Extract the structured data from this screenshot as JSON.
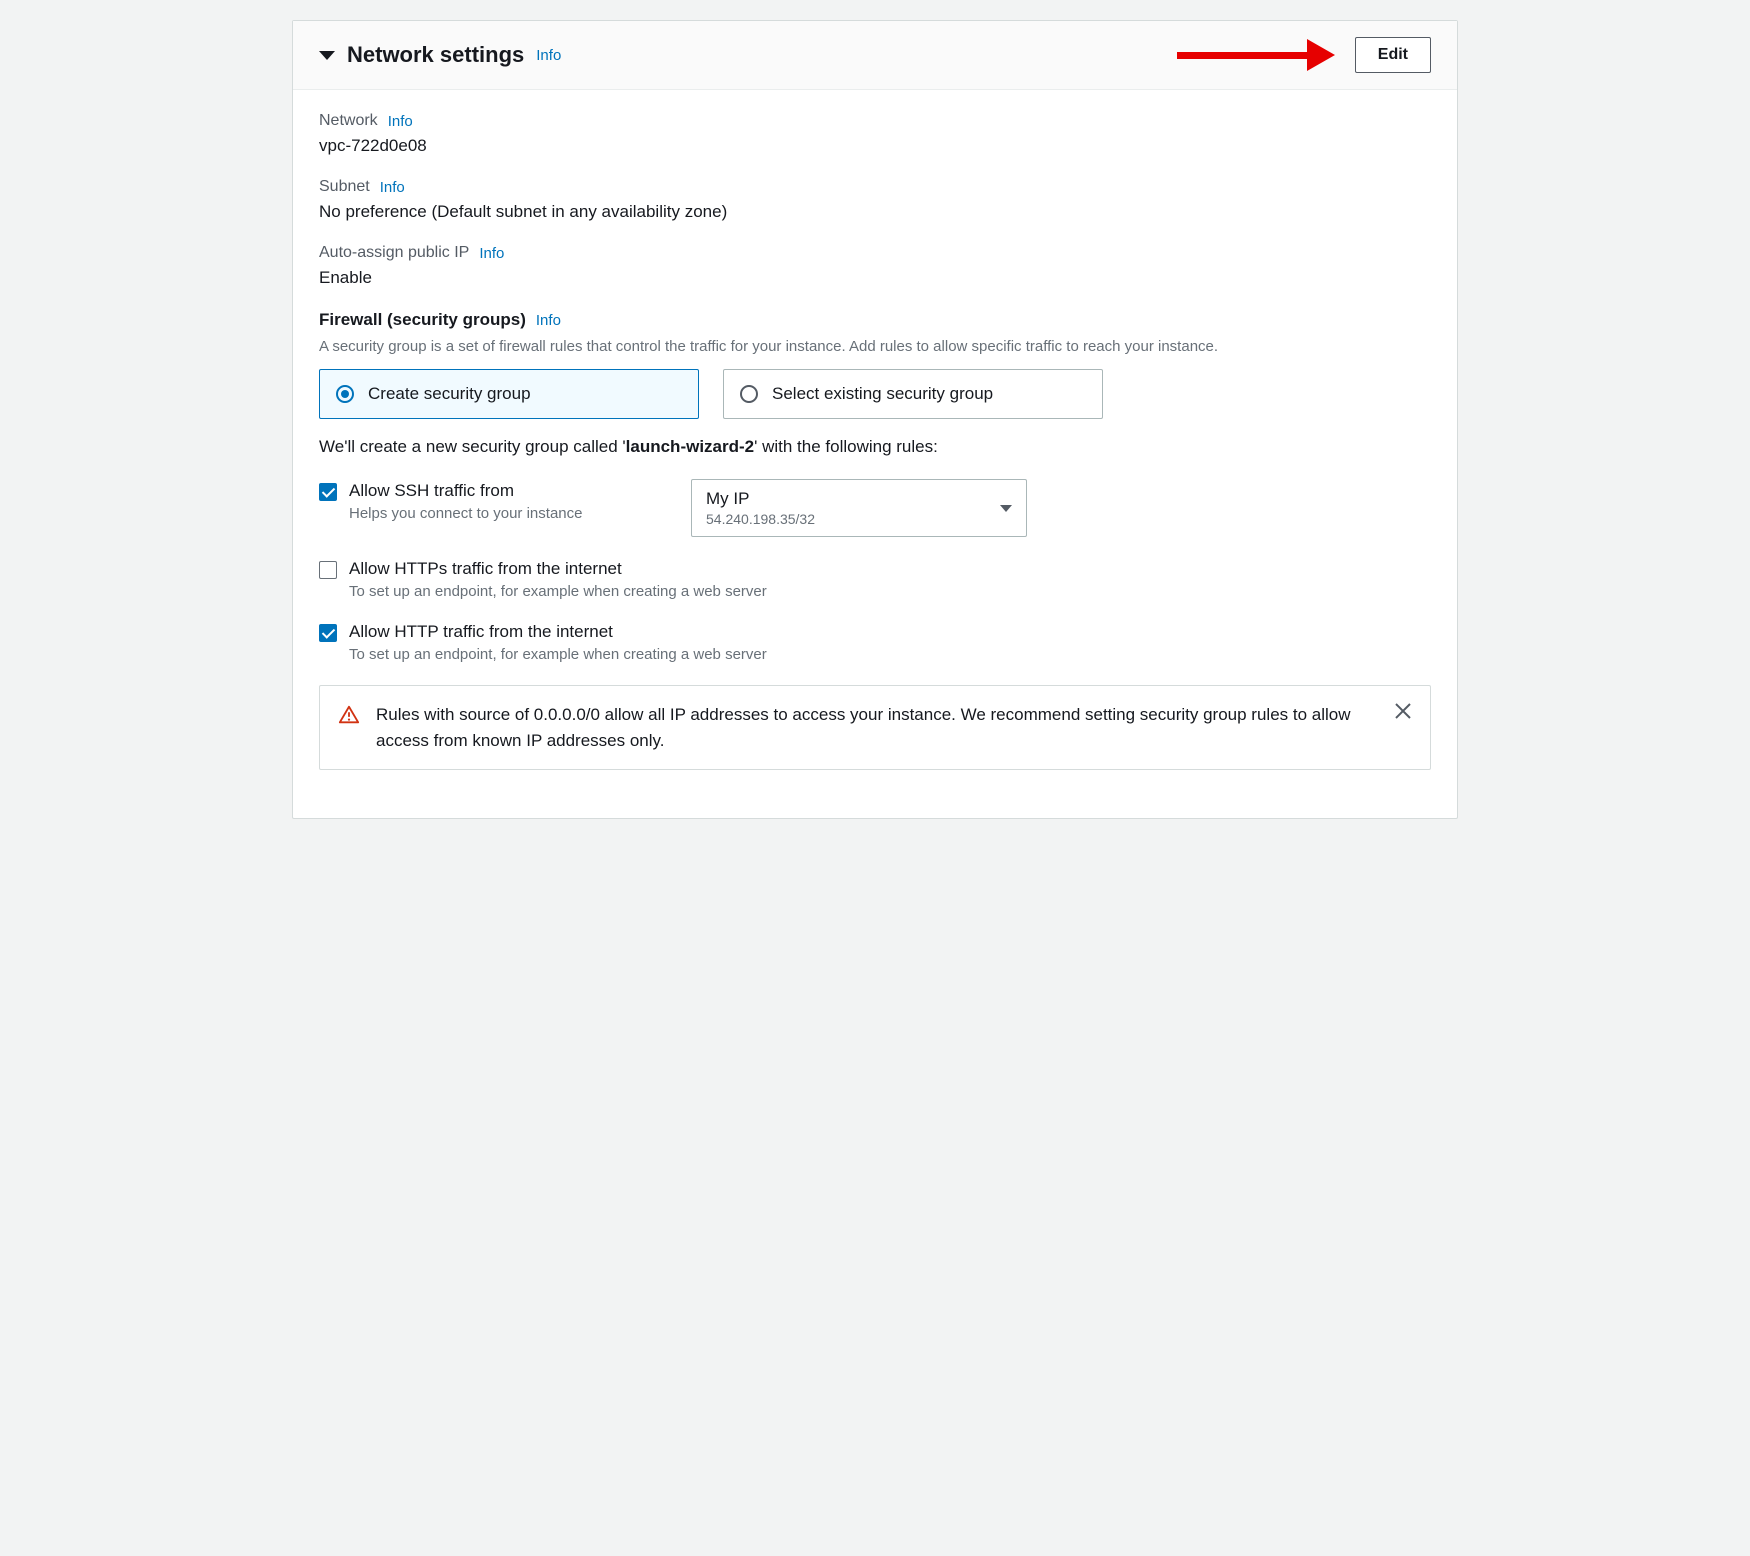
{
  "header": {
    "title": "Network settings",
    "info": "Info",
    "edit": "Edit"
  },
  "network": {
    "label": "Network",
    "info": "Info",
    "value": "vpc-722d0e08"
  },
  "subnet": {
    "label": "Subnet",
    "info": "Info",
    "value": "No preference (Default subnet in any availability zone)"
  },
  "auto_ip": {
    "label": "Auto-assign public IP",
    "info": "Info",
    "value": "Enable"
  },
  "firewall": {
    "title": "Firewall (security groups)",
    "info": "Info",
    "desc": "A security group is a set of firewall rules that control the traffic for your instance. Add rules to allow specific traffic to reach your instance.",
    "option_create": "Create security group",
    "option_select": "Select existing security group",
    "create_prefix": "We'll create a new security group called '",
    "create_name": "launch-wizard-2",
    "create_suffix": "' with the following rules:"
  },
  "rules": {
    "ssh": {
      "title": "Allow SSH traffic from",
      "help": "Helps you connect to your instance",
      "select_main": "My IP",
      "select_sub": "54.240.198.35/32"
    },
    "https": {
      "title": "Allow HTTPs traffic from the internet",
      "help": "To set up an endpoint, for example when creating a web server"
    },
    "http": {
      "title": "Allow HTTP traffic from the internet",
      "help": "To set up an endpoint, for example when creating a web server"
    }
  },
  "warning": {
    "text": "Rules with source of 0.0.0.0/0 allow all IP addresses to access your instance. We recommend setting security group rules to allow access from known IP addresses only."
  }
}
